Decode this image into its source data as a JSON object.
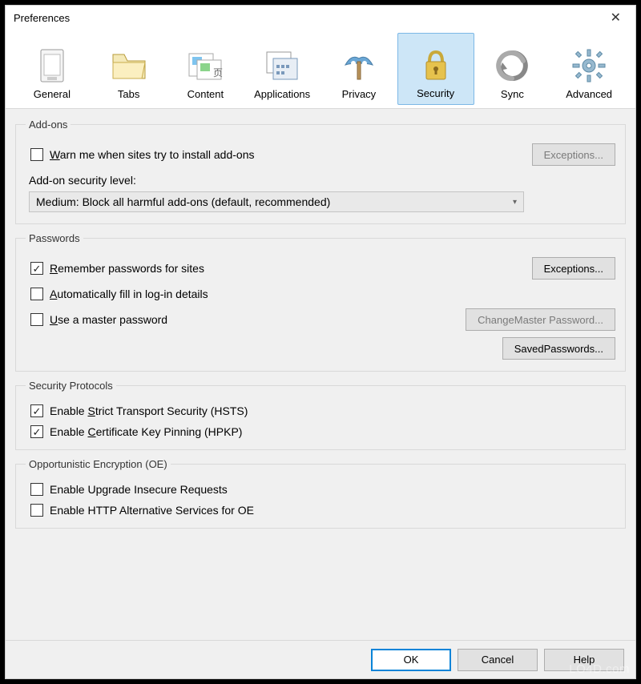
{
  "window": {
    "title": "Preferences"
  },
  "tabs": [
    {
      "id": "general",
      "label": "General"
    },
    {
      "id": "tabs",
      "label": "Tabs"
    },
    {
      "id": "content",
      "label": "Content"
    },
    {
      "id": "applications",
      "label": "Applications"
    },
    {
      "id": "privacy",
      "label": "Privacy"
    },
    {
      "id": "security",
      "label": "Security",
      "active": true
    },
    {
      "id": "sync",
      "label": "Sync"
    },
    {
      "id": "advanced",
      "label": "Advanced"
    }
  ],
  "groups": {
    "addons": {
      "legend": "Add-ons",
      "warn_checkbox": {
        "checked": false,
        "label_pre": "",
        "label_mn": "W",
        "label_post": "arn me when sites try to install add-ons"
      },
      "exceptions_btn": {
        "label_mn": "E",
        "label_post": "xceptions..."
      },
      "level_label": "Add-on security level:",
      "level_value": "Medium: Block all harmful add-ons (default, recommended)"
    },
    "passwords": {
      "legend": "Passwords",
      "remember": {
        "checked": true,
        "mn": "R",
        "post": "emember passwords for sites"
      },
      "exceptions_btn": {
        "mn": "E",
        "post": "xceptions..."
      },
      "autofill": {
        "checked": false,
        "mn": "A",
        "post": "utomatically fill in log-in details"
      },
      "master": {
        "checked": false,
        "mn": "U",
        "post": "se a master password"
      },
      "change_master_btn": {
        "pre": "Change ",
        "mn": "M",
        "post": "aster Password..."
      },
      "saved_btn": {
        "pre": "Saved ",
        "mn": "P",
        "post": "asswords..."
      }
    },
    "protocols": {
      "legend": "Security Protocols",
      "hsts": {
        "checked": true,
        "pre": "Enable ",
        "mn": "S",
        "post": "trict Transport Security (HSTS)"
      },
      "hpkp": {
        "checked": true,
        "pre": "Enable ",
        "mn": "C",
        "post": "ertificate Key Pinning (HPKP)"
      }
    },
    "oe": {
      "legend": "Opportunistic Encryption (OE)",
      "upgrade": {
        "checked": false,
        "label": "Enable Upgrade Insecure Requests"
      },
      "altsvc": {
        "checked": false,
        "label": "Enable HTTP Alternative Services for OE"
      }
    }
  },
  "footer": {
    "ok": "OK",
    "cancel": "Cancel",
    "help_mn": "H",
    "help_post": "elp"
  },
  "watermark": "LO4D.com"
}
